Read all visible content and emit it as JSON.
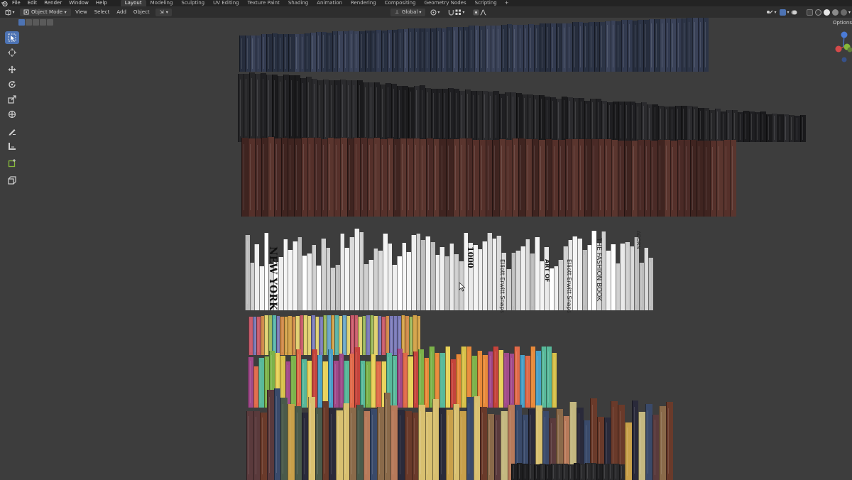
{
  "app": {
    "menus": [
      "File",
      "Edit",
      "Render",
      "Window",
      "Help"
    ],
    "workspaces": [
      "Layout",
      "Modeling",
      "Sculpting",
      "UV Editing",
      "Texture Paint",
      "Shading",
      "Animation",
      "Rendering",
      "Compositing",
      "Geometry Nodes",
      "Scripting"
    ],
    "active_workspace": "Layout",
    "add_tab": "+"
  },
  "header": {
    "editor_type_icon": "3d-viewport-icon",
    "mode": "Object Mode",
    "menus": [
      "View",
      "Select",
      "Add",
      "Object"
    ],
    "transform_orientation": "Global",
    "options_label": "Options",
    "accent_color": "#4d73b3"
  },
  "toolbar": {
    "tools": [
      "select-box-icon",
      "cursor-icon",
      "move-icon",
      "rotate-icon",
      "scale-icon",
      "transform-icon",
      "annotate-icon",
      "measure-icon",
      "add-cube-icon",
      "extrude-icon"
    ],
    "active_tool": "select-box-icon"
  },
  "gizmo": {
    "colors": {
      "x": "#d44a4a",
      "y": "#86b83a",
      "z": "#4b7bd6"
    }
  },
  "viewport": {
    "cover_texts": {
      "new_york": "NEW YORK",
      "n1000": "1000",
      "fashion": "THE FASHION BOOK",
      "elliott": "Elliott Erwitt Snaps",
      "art": "ART OF",
      "adorn": "ADORN"
    }
  }
}
